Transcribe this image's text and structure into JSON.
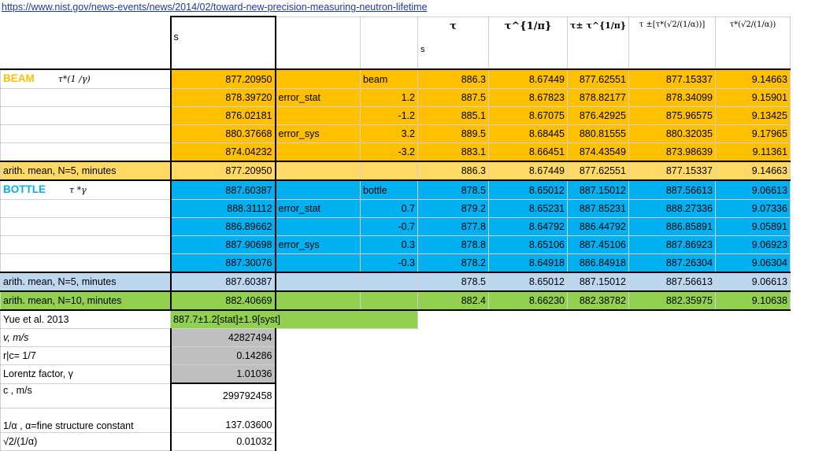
{
  "url": "https://www.nist.gov/news-events/news/2014/02/toward-new-precision-measuring-neutron-lifetime",
  "header": {
    "col_s": "s",
    "tau_symbol": "τ",
    "tau_unit": "s",
    "tau_pow": "τ^{1/π}",
    "tau_pm_pow": "τ± τ^{1/π}",
    "tau_pm_sqrt": "τ ±[τ*(√2/(1/α))]",
    "tau_sqrt": "τ*(√2/(1/α))"
  },
  "beam": {
    "label": "BEAM",
    "formula": "τ*(1 /γ)",
    "rows": [
      {
        "s": "877.20950",
        "tag": "",
        "delta": "",
        "note": "beam",
        "tau": "886.3",
        "pow": "8.67449",
        "pm_pow": "877.62551",
        "pm_sqrt": "877.15337",
        "sqrt": "9.14663"
      },
      {
        "s": "878.39720",
        "tag": "error_stat",
        "delta": "1.2",
        "note": "",
        "tau": "887.5",
        "pow": "8.67823",
        "pm_pow": "878.82177",
        "pm_sqrt": "878.34099",
        "sqrt": "9.15901"
      },
      {
        "s": "876.02181",
        "tag": "",
        "delta": "-1.2",
        "note": "",
        "tau": "885.1",
        "pow": "8.67075",
        "pm_pow": "876.42925",
        "pm_sqrt": "875.96575",
        "sqrt": "9.13425"
      },
      {
        "s": "880.37668",
        "tag": "error_sys",
        "delta": "3.2",
        "note": "",
        "tau": "889.5",
        "pow": "8.68445",
        "pm_pow": "880.81555",
        "pm_sqrt": "880.32035",
        "sqrt": "9.17965"
      },
      {
        "s": "874.04232",
        "tag": "",
        "delta": "-3.2",
        "note": "",
        "tau": "883.1",
        "pow": "8.66451",
        "pm_pow": "874.43549",
        "pm_sqrt": "873.98639",
        "sqrt": "9.11361"
      }
    ],
    "mean": {
      "label": "arith. mean, N=5,  minutes",
      "s": "877.20950",
      "tau": "886.3",
      "pow": "8.67449",
      "pm_pow": "877.62551",
      "pm_sqrt": "877.15337",
      "sqrt": "9.14663"
    }
  },
  "bottle": {
    "label": "BOTTLE",
    "formula": "τ *γ",
    "rows": [
      {
        "s": "887.60387",
        "tag": "",
        "delta": "",
        "note": "bottle",
        "tau": "878.5",
        "pow": "8.65012",
        "pm_pow": "887.15012",
        "pm_sqrt": "887.56613",
        "sqrt": "9.06613"
      },
      {
        "s": "888.31112",
        "tag": "error_stat",
        "delta": "0.7",
        "note": "",
        "tau": "879.2",
        "pow": "8.65231",
        "pm_pow": "887.85231",
        "pm_sqrt": "888.27336",
        "sqrt": "9.07336"
      },
      {
        "s": "886.89662",
        "tag": "",
        "delta": "-0.7",
        "note": "",
        "tau": "877.8",
        "pow": "8.64792",
        "pm_pow": "886.44792",
        "pm_sqrt": "886.85891",
        "sqrt": "9.05891"
      },
      {
        "s": "887.90698",
        "tag": "error_sys",
        "delta": "0.3",
        "note": "",
        "tau": "878.8",
        "pow": "8.65106",
        "pm_pow": "887.45106",
        "pm_sqrt": "887.86923",
        "sqrt": "9.06923"
      },
      {
        "s": "887.30076",
        "tag": "",
        "delta": "-0.3",
        "note": "",
        "tau": "878.2",
        "pow": "8.64918",
        "pm_pow": "886.84918",
        "pm_sqrt": "887.26304",
        "sqrt": "9.06304"
      }
    ],
    "mean": {
      "label": "arith. mean, N=5, minutes",
      "s": "887.60387",
      "tau": "878.5",
      "pow": "8.65012",
      "pm_pow": "887.15012",
      "pm_sqrt": "887.56613",
      "sqrt": "9.06613"
    }
  },
  "mean10": {
    "label": "arith. mean, N=10, minutes",
    "s": "882.40669",
    "tau": "882.4",
    "pow": "8.66230",
    "pm_pow": "882.38782",
    "pm_sqrt": "882.35975",
    "sqrt": "9.10638"
  },
  "constants": [
    {
      "label": "Yue et al. 2013",
      "value": "887.7±1.2[stat]±1.9[syst]",
      "style": "green"
    },
    {
      "label": "v, m/s",
      "value": "42827494",
      "style": "gray"
    },
    {
      "label": "r|c= 1/7",
      "value": "0.14286",
      "style": "gray"
    },
    {
      "label": "Lorentz factor, γ",
      "value": "1.01036",
      "style": "gray"
    },
    {
      "label": "c , m/s",
      "value": "299792458",
      "style": "white"
    },
    {
      "label": "1/α , α=fine structure constant",
      "value": "137.03600",
      "style": "white"
    },
    {
      "label": "√2/(1/α)",
      "value": "0.01032",
      "style": "white"
    }
  ]
}
